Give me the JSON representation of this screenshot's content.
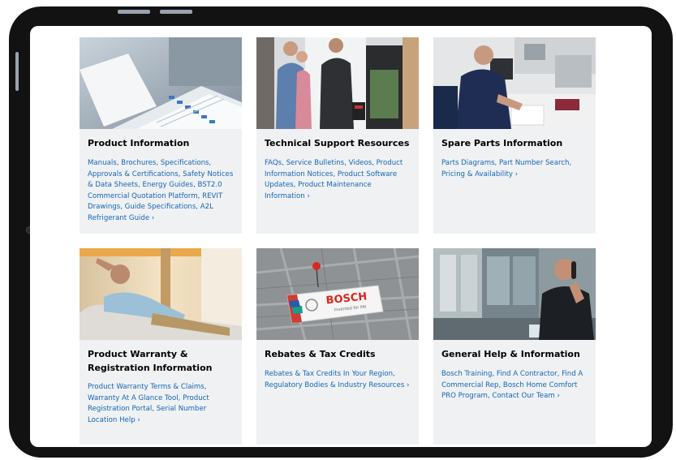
{
  "colors": {
    "link": "#1566b5",
    "card_bg": "#eff1f3",
    "bezel": "#121212"
  },
  "cards": [
    {
      "title": "Product Information",
      "links": "Manuals, Brochures, Specifications, Approvals & Certifications, Safety Notices & Data Sheets, Energy Guides, BST2.0 Commercial Quotation Platform, REVIT Drawings, Guide Specifications, A2L Refrigerant Guide ›"
    },
    {
      "title": "Technical Support Resources",
      "links": "FAQs, Service Bulletins, Videos, Product Information Notices, Product Software Updates, Product Maintenance Information ›"
    },
    {
      "title": "Spare Parts Information",
      "links": "Parts Diagrams, Part Number Search, Pricing & Availability ›"
    },
    {
      "title": "Product Warranty & Registration Information",
      "links": "Product Warranty Terms & Claims, Warranty At A Glance Tool, Product Registration Portal, Serial Number Location Help ›"
    },
    {
      "title": "Rebates & Tax Credits",
      "links": "Rebates & Tax Credits In Your Region, Regulatory Bodies & Industry Resources ›",
      "image_brand": "BOSCH",
      "image_tagline": "Invented for life"
    },
    {
      "title": "General Help & Information",
      "links": "Bosch Training, Find A Contractor, Find A Commercial Rep, Bosch Home Comfort PRO Program, Contact Our Team ›"
    }
  ]
}
